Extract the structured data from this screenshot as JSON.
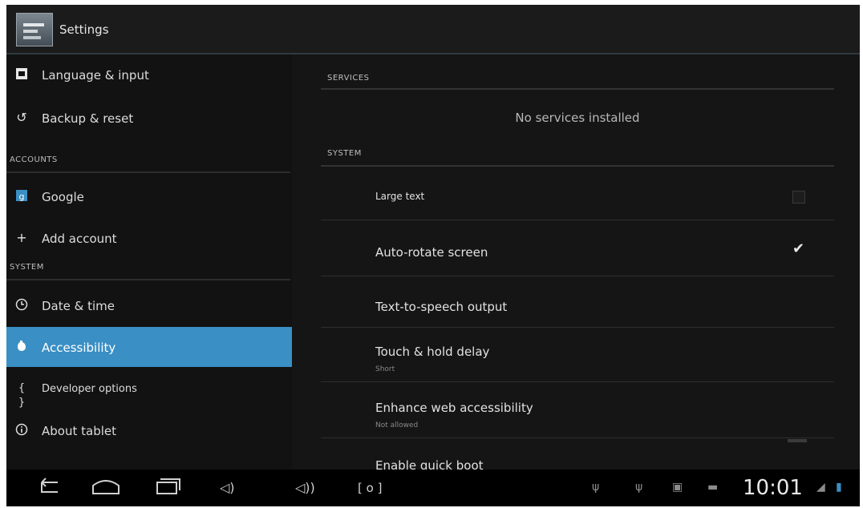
{
  "actionbar": {
    "title": "Settings"
  },
  "left": {
    "items_top": [
      {
        "icon": "keyboard-icon",
        "label": "Language & input"
      },
      {
        "icon": "backup-restore-icon",
        "label": "Backup & reset"
      }
    ],
    "accounts_header": "ACCOUNTS",
    "accounts": [
      {
        "icon": "google-icon",
        "label": "Google"
      },
      {
        "icon": "plus-icon",
        "label": "Add account"
      }
    ],
    "system_header": "SYSTEM",
    "system": [
      {
        "icon": "clock-icon",
        "label": "Date & time"
      },
      {
        "icon": "accessibility-hand-icon",
        "label": "Accessibility",
        "selected": true
      },
      {
        "icon": "braces-icon",
        "label": "Developer options"
      },
      {
        "icon": "info-icon",
        "label": "About tablet"
      }
    ]
  },
  "right": {
    "services_header": "SERVICES",
    "no_services": "No services installed",
    "system_header": "SYSTEM",
    "items": [
      {
        "title": "Large text",
        "checked": false
      },
      {
        "title": "Auto-rotate screen",
        "checked": true
      },
      {
        "title": "Text-to-speech output"
      },
      {
        "title": "Touch & hold delay",
        "summary": "Short"
      },
      {
        "title": "Enhance web accessibility",
        "summary": "Not allowed"
      },
      {
        "title": "Enable quick boot"
      }
    ]
  },
  "navbar": {
    "buttons": [
      "back-icon",
      "home-icon",
      "recent-apps-icon",
      "volume-down-icon",
      "volume-up-icon",
      "screenshot-icon"
    ],
    "clock": "10:01",
    "status_icons": [
      "usb-icon",
      "usb-icon",
      "image-icon",
      "sd-card-icon",
      "wifi-icon",
      "battery-icon"
    ]
  },
  "colors": {
    "accent": "#3a8fc4",
    "background": "#131313"
  }
}
